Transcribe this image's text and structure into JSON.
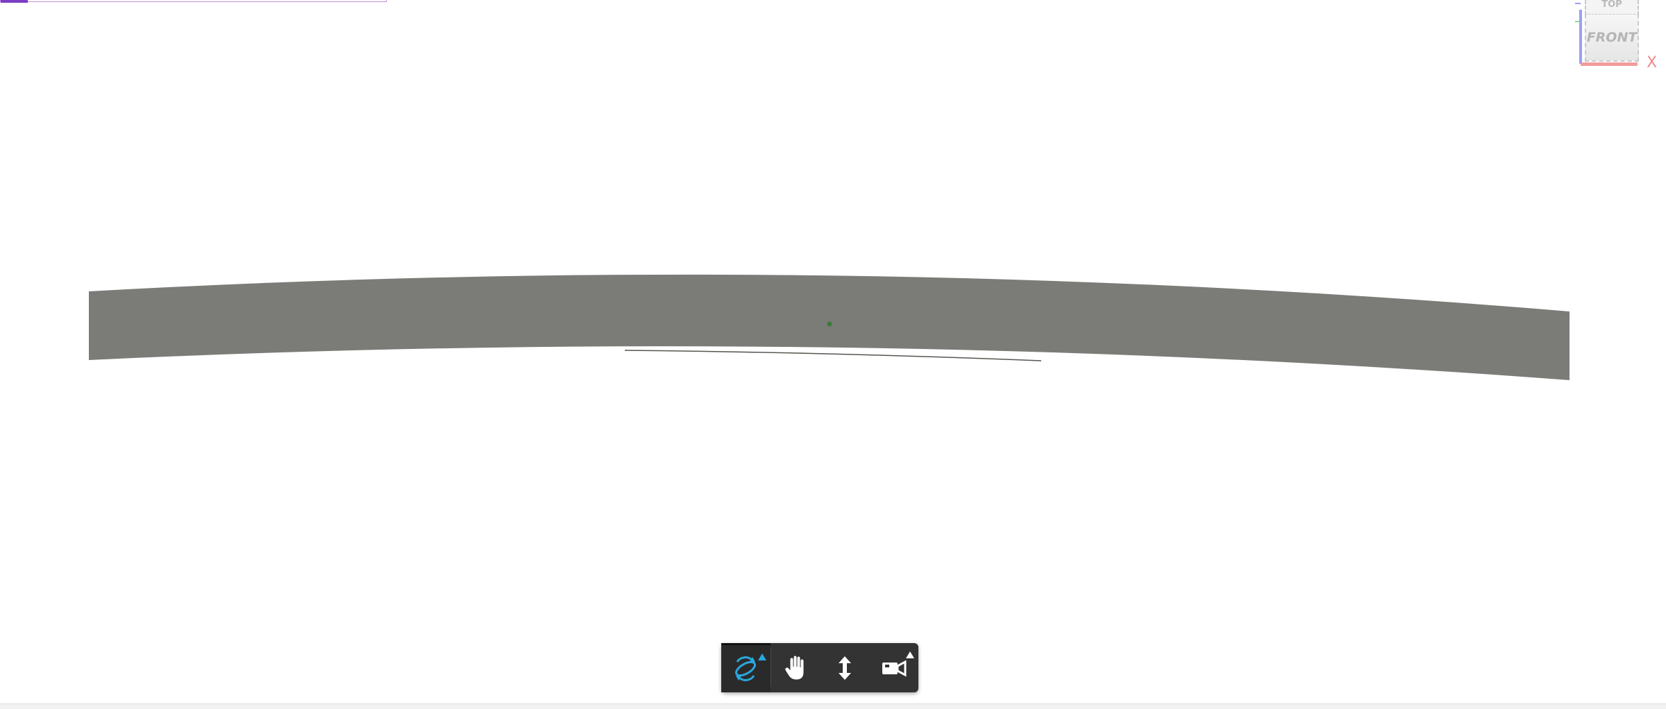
{
  "loading": {
    "progress": 0.07
  },
  "viewcube": {
    "top_label": "TOP",
    "front_label": "FRONT",
    "x_axis_label": "X",
    "colors": {
      "x_axis": "#f29b9b",
      "y_axis": "#8fd98f",
      "z_axis": "#9aa0f2"
    }
  },
  "model": {
    "name": "curved-panel",
    "color": "#7b7c77",
    "pivot_color": "#3b7a3b"
  },
  "toolbar": {
    "tools": [
      {
        "id": "orbit",
        "icon": "orbit-icon",
        "active": true,
        "has_flyout": true
      },
      {
        "id": "pan",
        "icon": "hand-pan-icon",
        "active": false,
        "has_flyout": false
      },
      {
        "id": "zoom",
        "icon": "dolly-zoom-icon",
        "active": false,
        "has_flyout": false
      },
      {
        "id": "camera",
        "icon": "camera-icon",
        "active": false,
        "has_flyout": true
      }
    ],
    "colors": {
      "background": "#333333",
      "accent": "#2aa7de",
      "icon": "#ffffff"
    }
  }
}
